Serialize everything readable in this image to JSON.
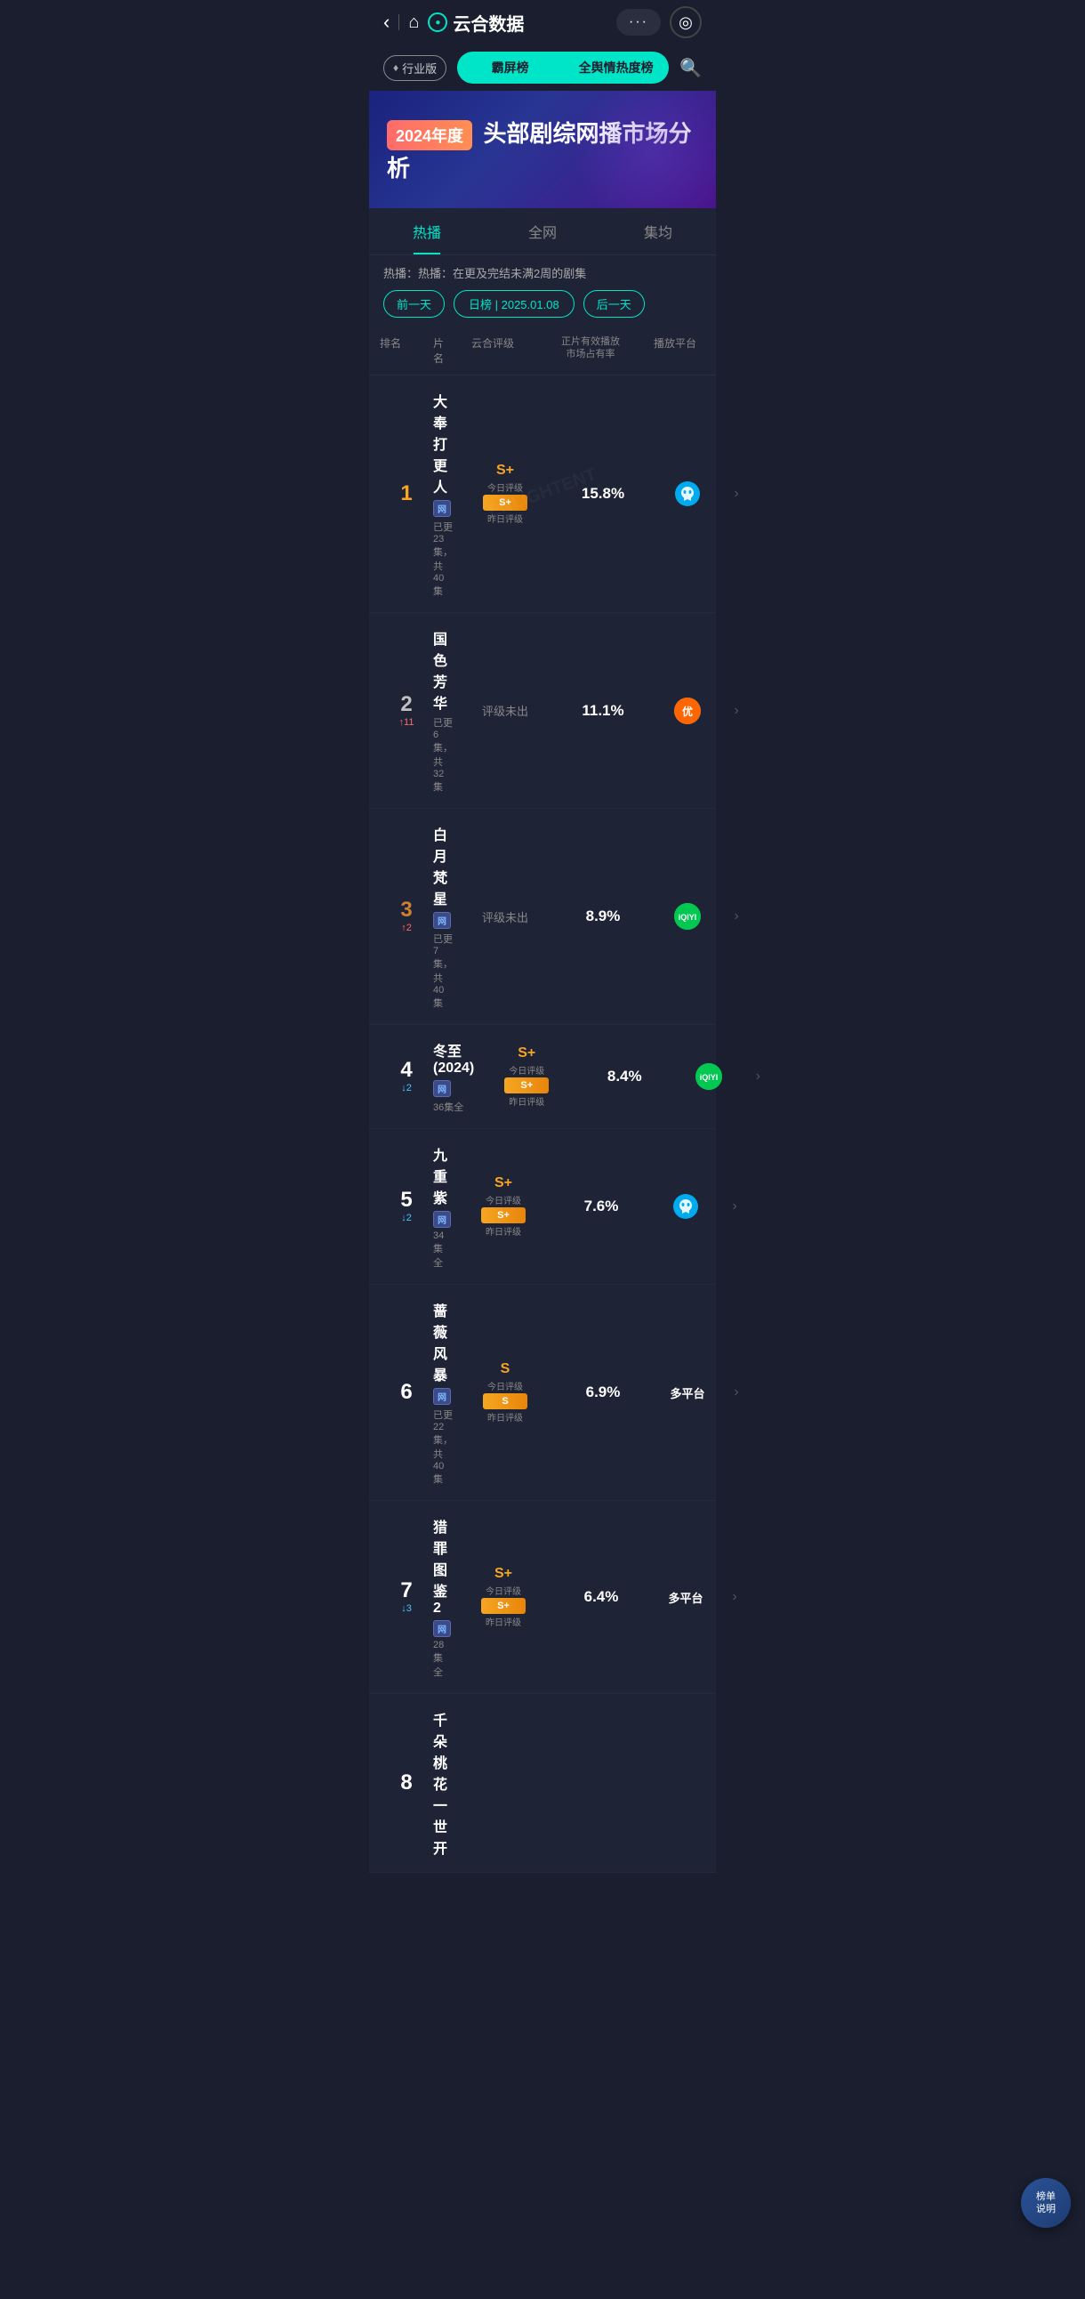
{
  "app": {
    "title": "云合数据",
    "back_label": "‹",
    "home_label": "⌂",
    "more_label": "···",
    "scan_label": "◎"
  },
  "nav": {
    "industry_badge": "行业版",
    "tab1": "霸屏榜",
    "tab2": "全舆情热度榜",
    "search_label": "🔍"
  },
  "banner": {
    "year_tag": "2024年度",
    "title": "头部剧综网播市场分析"
  },
  "content_tabs": [
    {
      "label": "热播",
      "active": true
    },
    {
      "label": "全网",
      "active": false
    },
    {
      "label": "集均",
      "active": false
    }
  ],
  "filter": {
    "desc": "热播：在更及完结未满2周的剧集",
    "prev_label": "前一天",
    "current_date": "日榜 | 2025.01.08",
    "next_label": "后一天"
  },
  "table": {
    "headers": [
      "排名",
      "片名",
      "云合评级",
      "正片有效播放市场占有率",
      "播放平台",
      ""
    ],
    "rows": [
      {
        "rank": "1",
        "change": "",
        "change_dir": "none",
        "title": "大奉打更人",
        "online": true,
        "episodes": "已更23集，共40集",
        "rating_grade": "S+",
        "rating_today": "今日评级",
        "rating_bar": "S+",
        "rating_yesterday": "昨日评级",
        "market": "15.8%",
        "platform": "tencent",
        "platform_label": ""
      },
      {
        "rank": "2",
        "change": "11",
        "change_dir": "up",
        "title": "国色芳华",
        "online": false,
        "episodes": "已更6集，共32集",
        "rating_grade": "",
        "rating_today": "",
        "rating_bar": "",
        "rating_yesterday": "",
        "rating_no": "评级未出",
        "market": "11.1%",
        "platform": "youku",
        "platform_label": ""
      },
      {
        "rank": "3",
        "change": "2",
        "change_dir": "up",
        "title": "白月梵星",
        "online": true,
        "episodes": "已更7集，共40集",
        "rating_grade": "",
        "rating_today": "",
        "rating_bar": "",
        "rating_yesterday": "",
        "rating_no": "评级未出",
        "market": "8.9%",
        "platform": "iqiyi",
        "platform_label": ""
      },
      {
        "rank": "4",
        "change": "2",
        "change_dir": "down",
        "title": "冬至(2024)",
        "online": true,
        "episodes": "36集全",
        "rating_grade": "S+",
        "rating_today": "今日评级",
        "rating_bar": "S+",
        "rating_yesterday": "昨日评级",
        "market": "8.4%",
        "platform": "iqiyi",
        "platform_label": ""
      },
      {
        "rank": "5",
        "change": "2",
        "change_dir": "down",
        "title": "九重紫",
        "online": true,
        "episodes": "34集全",
        "rating_grade": "S+",
        "rating_today": "今日评级",
        "rating_bar": "S+",
        "rating_yesterday": "昨日评级",
        "market": "7.6%",
        "platform": "tencent",
        "platform_label": ""
      },
      {
        "rank": "6",
        "change": "",
        "change_dir": "none",
        "title": "蔷薇风暴",
        "online": true,
        "episodes": "已更22集，共40集",
        "rating_grade": "S",
        "rating_today": "今日评级",
        "rating_bar": "S",
        "rating_yesterday": "昨日评级",
        "market": "6.9%",
        "platform": "multi",
        "platform_label": "多平台"
      },
      {
        "rank": "7",
        "change": "3",
        "change_dir": "down",
        "title": "猎罪图鉴2",
        "online": true,
        "episodes": "28集全",
        "rating_grade": "S+",
        "rating_today": "今日评级",
        "rating_bar": "S+",
        "rating_yesterday": "昨日评级",
        "market": "6.4%",
        "platform": "multi",
        "platform_label": "多平台"
      },
      {
        "rank": "8",
        "change": "",
        "change_dir": "none",
        "title": "千朵桃花一世开",
        "online": false,
        "episodes": "",
        "rating_grade": "",
        "rating_today": "",
        "rating_bar": "",
        "rating_yesterday": "",
        "rating_no": "",
        "market": "",
        "platform": "",
        "platform_label": ""
      }
    ]
  },
  "float_btn": {
    "label": "榜单\n说明"
  }
}
